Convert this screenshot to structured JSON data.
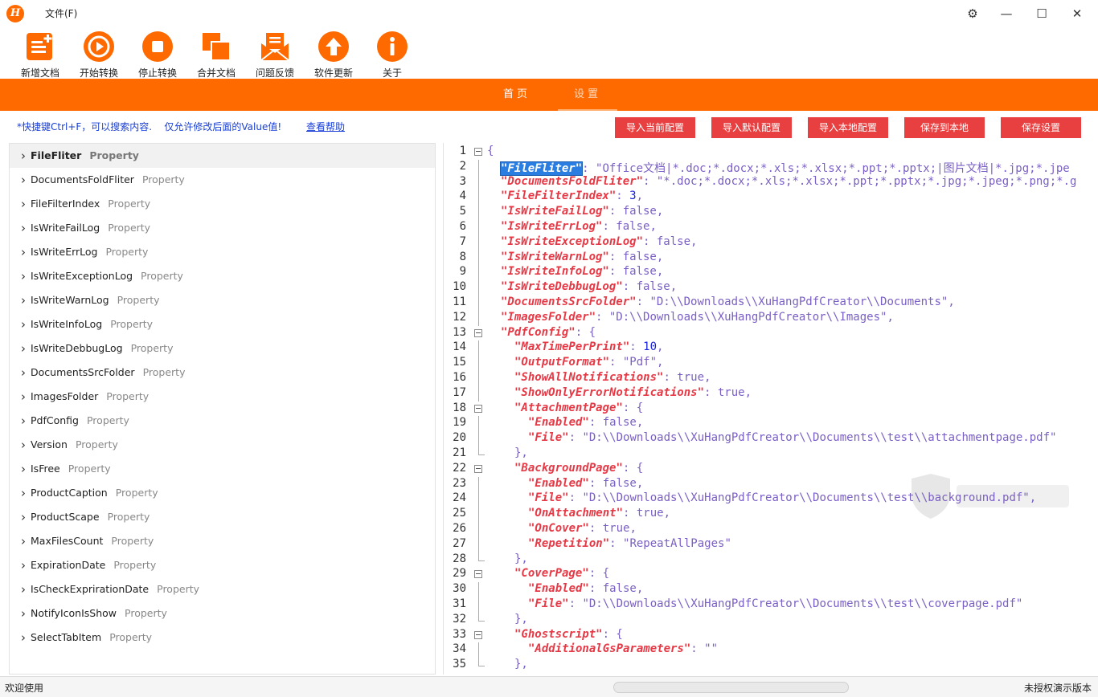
{
  "titlebar": {
    "logo_letter": "H",
    "menu_file": "文件(F)",
    "buttons": {
      "settings_glyph": "⚙",
      "minimize_glyph": "—",
      "maximize_glyph": "☐",
      "close_glyph": "✕"
    }
  },
  "toolbar": {
    "items": [
      {
        "label": "新增文档",
        "icon": "new-document-icon"
      },
      {
        "label": "开始转换",
        "icon": "play-icon"
      },
      {
        "label": "停止转换",
        "icon": "stop-icon"
      },
      {
        "label": "合并文档",
        "icon": "merge-icon"
      },
      {
        "label": "问题反馈",
        "icon": "mail-icon"
      },
      {
        "label": "软件更新",
        "icon": "upload-arrow-icon"
      },
      {
        "label": "关于",
        "icon": "info-icon"
      }
    ]
  },
  "nav": {
    "tabs": [
      {
        "label": "首页"
      },
      {
        "label": "设置"
      }
    ],
    "active_index": 1
  },
  "info": {
    "tip": "*快捷键Ctrl+F，可以搜索内容.    仅允许修改后面的Value值!",
    "help_link": "查看帮助"
  },
  "actions": [
    "导入当前配置",
    "导入默认配置",
    "导入本地配置",
    "保存到本地",
    "保存设置"
  ],
  "properties": {
    "type_label": "Property",
    "items": [
      "FileFliter",
      "DocumentsFoldFliter",
      "FileFilterIndex",
      "IsWriteFailLog",
      "IsWriteErrLog",
      "IsWriteExceptionLog",
      "IsWriteWarnLog",
      "IsWriteInfoLog",
      "IsWriteDebbugLog",
      "DocumentsSrcFolder",
      "ImagesFolder",
      "PdfConfig",
      "Version",
      "IsFree",
      "ProductCaption",
      "ProductScape",
      "MaxFilesCount",
      "ExpirationDate",
      "IsCheckExprirationDate",
      "NotifyIconIsShow",
      "SelectTabItem"
    ],
    "selected_index": 0
  },
  "editor": {
    "lines": [
      {
        "n": "1",
        "indent": 0,
        "parts": [
          [
            "p",
            "{"
          ]
        ]
      },
      {
        "n": "2",
        "indent": 1,
        "parts": [
          [
            "k",
            "\"FileFliter\"",
            true
          ],
          [
            "p",
            ": "
          ],
          [
            "s",
            "\"Office文档|*.doc;*.docx;*.xls;*.xlsx;*.ppt;*.pptx;|图片文档|*.jpg;*.jpe"
          ]
        ]
      },
      {
        "n": "3",
        "indent": 1,
        "parts": [
          [
            "k",
            "\"DocumentsFoldFliter\""
          ],
          [
            "p",
            ": "
          ],
          [
            "s",
            "\"*.doc;*.docx;*.xls;*.xlsx;*.ppt;*.pptx;*.jpg;*.jpeg;*.png;*.g"
          ]
        ]
      },
      {
        "n": "4",
        "indent": 1,
        "parts": [
          [
            "k",
            "\"FileFilterIndex\""
          ],
          [
            "p",
            ": "
          ],
          [
            "n",
            "3"
          ],
          [
            "p",
            ","
          ]
        ]
      },
      {
        "n": "5",
        "indent": 1,
        "parts": [
          [
            "k",
            "\"IsWriteFailLog\""
          ],
          [
            "p",
            ": "
          ],
          [
            "b",
            "false"
          ],
          [
            "p",
            ","
          ]
        ]
      },
      {
        "n": "6",
        "indent": 1,
        "parts": [
          [
            "k",
            "\"IsWriteErrLog\""
          ],
          [
            "p",
            ": "
          ],
          [
            "b",
            "false"
          ],
          [
            "p",
            ","
          ]
        ]
      },
      {
        "n": "7",
        "indent": 1,
        "parts": [
          [
            "k",
            "\"IsWriteExceptionLog\""
          ],
          [
            "p",
            ": "
          ],
          [
            "b",
            "false"
          ],
          [
            "p",
            ","
          ]
        ]
      },
      {
        "n": "8",
        "indent": 1,
        "parts": [
          [
            "k",
            "\"IsWriteWarnLog\""
          ],
          [
            "p",
            ": "
          ],
          [
            "b",
            "false"
          ],
          [
            "p",
            ","
          ]
        ]
      },
      {
        "n": "9",
        "indent": 1,
        "parts": [
          [
            "k",
            "\"IsWriteInfoLog\""
          ],
          [
            "p",
            ": "
          ],
          [
            "b",
            "false"
          ],
          [
            "p",
            ","
          ]
        ]
      },
      {
        "n": "10",
        "indent": 1,
        "parts": [
          [
            "k",
            "\"IsWriteDebbugLog\""
          ],
          [
            "p",
            ": "
          ],
          [
            "b",
            "false"
          ],
          [
            "p",
            ","
          ]
        ]
      },
      {
        "n": "11",
        "indent": 1,
        "parts": [
          [
            "k",
            "\"DocumentsSrcFolder\""
          ],
          [
            "p",
            ": "
          ],
          [
            "s",
            "\"D:\\\\Downloads\\\\XuHangPdfCreator\\\\Documents\""
          ],
          [
            "p",
            ","
          ]
        ]
      },
      {
        "n": "12",
        "indent": 1,
        "parts": [
          [
            "k",
            "\"ImagesFolder\""
          ],
          [
            "p",
            ": "
          ],
          [
            "s",
            "\"D:\\\\Downloads\\\\XuHangPdfCreator\\\\Images\""
          ],
          [
            "p",
            ","
          ]
        ]
      },
      {
        "n": "13",
        "indent": 1,
        "parts": [
          [
            "k",
            "\"PdfConfig\""
          ],
          [
            "p",
            ": {"
          ]
        ]
      },
      {
        "n": "14",
        "indent": 2,
        "parts": [
          [
            "k",
            "\"MaxTimePerPrint\""
          ],
          [
            "p",
            ": "
          ],
          [
            "n",
            "10"
          ],
          [
            "p",
            ","
          ]
        ]
      },
      {
        "n": "15",
        "indent": 2,
        "parts": [
          [
            "k",
            "\"OutputFormat\""
          ],
          [
            "p",
            ": "
          ],
          [
            "s",
            "\"Pdf\""
          ],
          [
            "p",
            ","
          ]
        ]
      },
      {
        "n": "16",
        "indent": 2,
        "parts": [
          [
            "k",
            "\"ShowAllNotifications\""
          ],
          [
            "p",
            ": "
          ],
          [
            "b",
            "true"
          ],
          [
            "p",
            ","
          ]
        ]
      },
      {
        "n": "17",
        "indent": 2,
        "parts": [
          [
            "k",
            "\"ShowOnlyErrorNotifications\""
          ],
          [
            "p",
            ": "
          ],
          [
            "b",
            "true"
          ],
          [
            "p",
            ","
          ]
        ]
      },
      {
        "n": "18",
        "indent": 2,
        "parts": [
          [
            "k",
            "\"AttachmentPage\""
          ],
          [
            "p",
            ": {"
          ]
        ]
      },
      {
        "n": "19",
        "indent": 3,
        "parts": [
          [
            "k",
            "\"Enabled\""
          ],
          [
            "p",
            ": "
          ],
          [
            "b",
            "false"
          ],
          [
            "p",
            ","
          ]
        ]
      },
      {
        "n": "20",
        "indent": 3,
        "parts": [
          [
            "k",
            "\"File\""
          ],
          [
            "p",
            ": "
          ],
          [
            "s",
            "\"D:\\\\Downloads\\\\XuHangPdfCreator\\\\Documents\\\\test\\\\attachmentpage.pdf\""
          ]
        ]
      },
      {
        "n": "21",
        "indent": 2,
        "parts": [
          [
            "p",
            "},"
          ]
        ]
      },
      {
        "n": "22",
        "indent": 2,
        "parts": [
          [
            "k",
            "\"BackgroundPage\""
          ],
          [
            "p",
            ": {"
          ]
        ]
      },
      {
        "n": "23",
        "indent": 3,
        "parts": [
          [
            "k",
            "\"Enabled\""
          ],
          [
            "p",
            ": "
          ],
          [
            "b",
            "false"
          ],
          [
            "p",
            ","
          ]
        ]
      },
      {
        "n": "24",
        "indent": 3,
        "parts": [
          [
            "k",
            "\"File\""
          ],
          [
            "p",
            ": "
          ],
          [
            "s",
            "\"D:\\\\Downloads\\\\XuHangPdfCreator\\\\Documents\\\\test\\\\background.pdf\""
          ],
          [
            "p",
            ","
          ]
        ]
      },
      {
        "n": "25",
        "indent": 3,
        "parts": [
          [
            "k",
            "\"OnAttachment\""
          ],
          [
            "p",
            ": "
          ],
          [
            "b",
            "true"
          ],
          [
            "p",
            ","
          ]
        ]
      },
      {
        "n": "26",
        "indent": 3,
        "parts": [
          [
            "k",
            "\"OnCover\""
          ],
          [
            "p",
            ": "
          ],
          [
            "b",
            "true"
          ],
          [
            "p",
            ","
          ]
        ]
      },
      {
        "n": "27",
        "indent": 3,
        "parts": [
          [
            "k",
            "\"Repetition\""
          ],
          [
            "p",
            ": "
          ],
          [
            "s",
            "\"RepeatAllPages\""
          ]
        ]
      },
      {
        "n": "28",
        "indent": 2,
        "parts": [
          [
            "p",
            "},"
          ]
        ]
      },
      {
        "n": "29",
        "indent": 2,
        "parts": [
          [
            "k",
            "\"CoverPage\""
          ],
          [
            "p",
            ": {"
          ]
        ]
      },
      {
        "n": "30",
        "indent": 3,
        "parts": [
          [
            "k",
            "\"Enabled\""
          ],
          [
            "p",
            ": "
          ],
          [
            "b",
            "false"
          ],
          [
            "p",
            ","
          ]
        ]
      },
      {
        "n": "31",
        "indent": 3,
        "parts": [
          [
            "k",
            "\"File\""
          ],
          [
            "p",
            ": "
          ],
          [
            "s",
            "\"D:\\\\Downloads\\\\XuHangPdfCreator\\\\Documents\\\\test\\\\coverpage.pdf\""
          ]
        ]
      },
      {
        "n": "32",
        "indent": 2,
        "parts": [
          [
            "p",
            "},"
          ]
        ]
      },
      {
        "n": "33",
        "indent": 2,
        "parts": [
          [
            "k",
            "\"Ghostscript\""
          ],
          [
            "p",
            ": {"
          ]
        ]
      },
      {
        "n": "34",
        "indent": 3,
        "parts": [
          [
            "k",
            "\"AdditionalGsParameters\""
          ],
          [
            "p",
            ": "
          ],
          [
            "s",
            "\"\""
          ]
        ]
      },
      {
        "n": "35",
        "indent": 2,
        "parts": [
          [
            "p",
            "},"
          ]
        ]
      }
    ],
    "fold_lines": [
      "1",
      "13",
      "18",
      "22",
      "29",
      "33"
    ],
    "fold_ends": [
      "21",
      "28",
      "32",
      "35"
    ]
  },
  "status": {
    "left": "欢迎使用",
    "progress": 0,
    "right": "未授权演示版本"
  },
  "colors": {
    "accent": "#ff6a00",
    "action_button": "#e84040",
    "link": "#1a3fd6"
  }
}
